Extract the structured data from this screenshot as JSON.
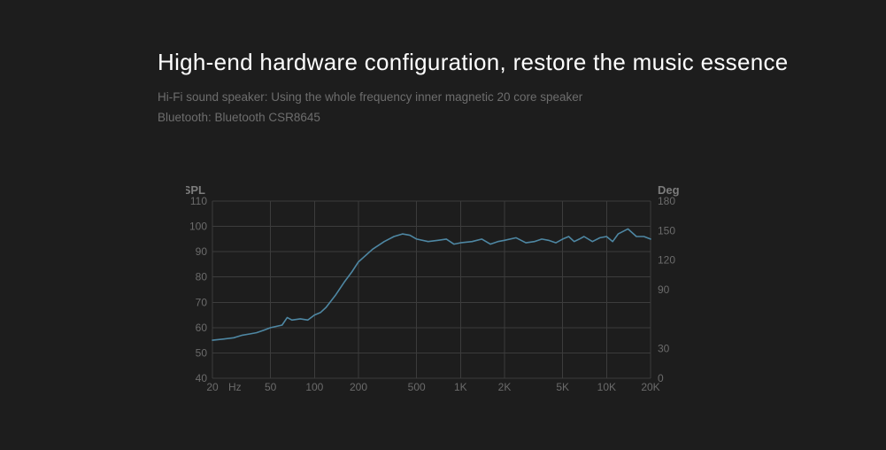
{
  "title": "High-end hardware configuration, restore the music essence",
  "sub1": "Hi-Fi sound speaker: Using the whole frequency inner magnetic 20 core speaker",
  "sub2": "Bluetooth: Bluetooth CSR8645",
  "chart_data": {
    "type": "line",
    "title": "",
    "xlabel": "Hz",
    "ylabel": "dBSPL",
    "ylabel_right": "Deg",
    "ylim": [
      40,
      110
    ],
    "ylim_right": [
      0,
      180
    ],
    "x_ticks": [
      "20",
      "50",
      "100",
      "200",
      "500",
      "1K",
      "2K",
      "5K",
      "10K",
      "20K"
    ],
    "y_ticks": [
      40,
      50,
      60,
      70,
      80,
      90,
      100,
      110
    ],
    "y_ticks_right": [
      0,
      30,
      90,
      120,
      150,
      180
    ],
    "x": [
      20,
      24,
      28,
      32,
      36,
      40,
      45,
      50,
      55,
      60,
      65,
      70,
      80,
      90,
      100,
      110,
      120,
      140,
      160,
      180,
      200,
      250,
      300,
      350,
      400,
      450,
      500,
      600,
      700,
      800,
      900,
      1000,
      1200,
      1400,
      1600,
      1800,
      2000,
      2400,
      2800,
      3200,
      3600,
      4000,
      4500,
      5000,
      5500,
      6000,
      6500,
      7000,
      8000,
      9000,
      10000,
      11000,
      12000,
      14000,
      16000,
      18000,
      20000
    ],
    "values": [
      55,
      55.5,
      56,
      57,
      57.5,
      58,
      59,
      60,
      60.5,
      61,
      64,
      63,
      63.5,
      63,
      65,
      66,
      68,
      73,
      78,
      82,
      86,
      91,
      94,
      96,
      97,
      96.5,
      95,
      94,
      94.5,
      95,
      93,
      93.5,
      94,
      95,
      93,
      94,
      94.5,
      95.5,
      93.5,
      94,
      95,
      94.5,
      93.5,
      95,
      96,
      94,
      95,
      96,
      94,
      95.5,
      96,
      94,
      97,
      99,
      96,
      96,
      95
    ]
  }
}
